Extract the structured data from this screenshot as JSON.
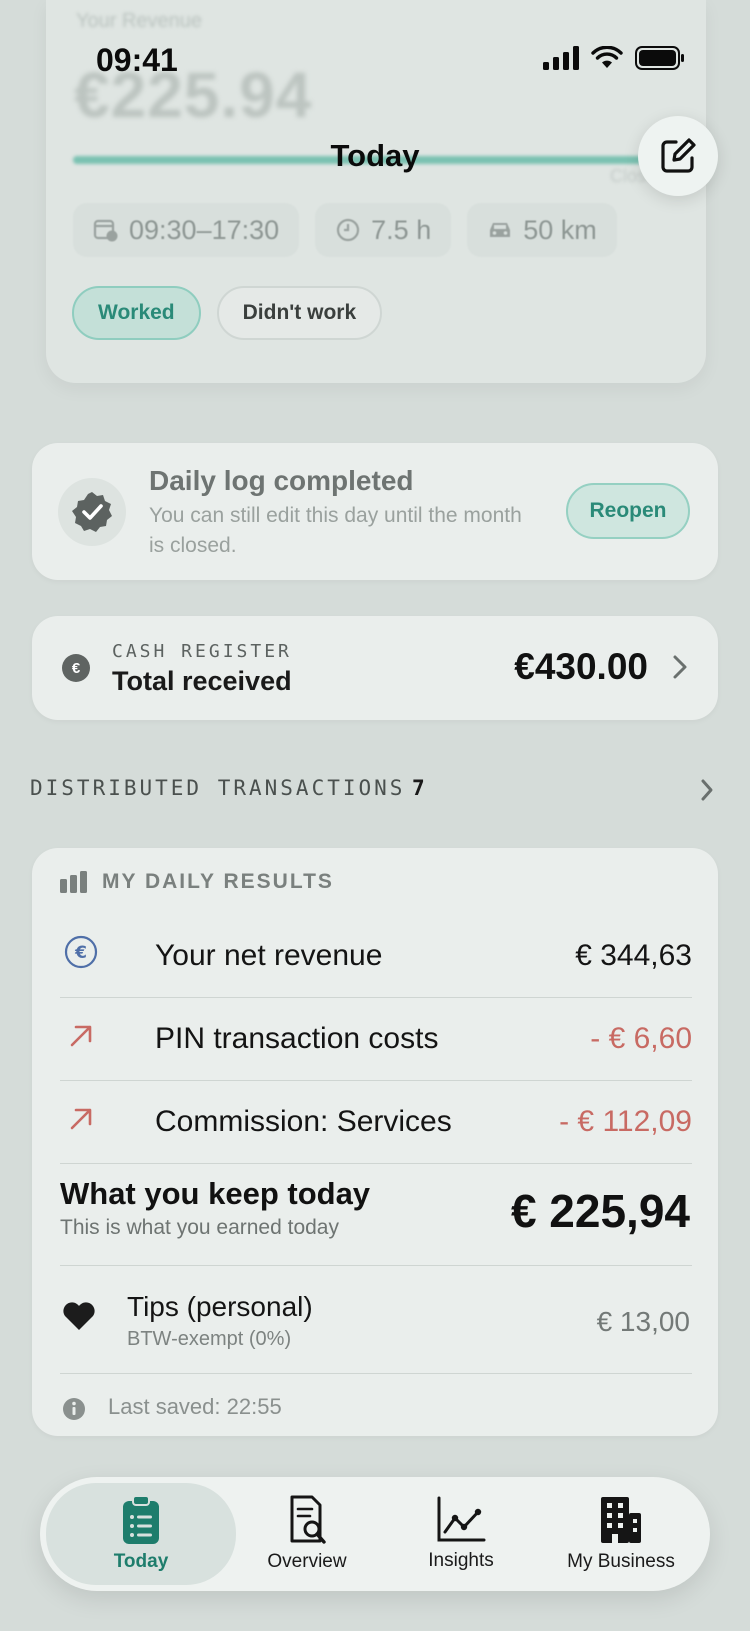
{
  "status_bar": {
    "time": "09:41"
  },
  "header": {
    "title": "Today"
  },
  "summary_card": {
    "ghost_label": "Your Revenue",
    "ghost_amount": "€225.94",
    "ghost_right": "Close",
    "progress": 0.95,
    "shift_time": "09:30–17:30",
    "hours": "7.5 h",
    "distance": "50 km",
    "worked_label": "Worked",
    "didnt_work_label": "Didn't work"
  },
  "daily_log": {
    "title": "Daily log completed",
    "subtitle": "You can still edit this day until the month is closed.",
    "reopen_label": "Reopen"
  },
  "cash_register": {
    "currency_symbol": "€",
    "eyebrow": "CASH REGISTER",
    "label": "Total received",
    "amount": "€430.00"
  },
  "distributed": {
    "label": "DISTRIBUTED TRANSACTIONS",
    "count": "7"
  },
  "daily_results": {
    "title": "MY DAILY RESULTS",
    "rows": [
      {
        "label": "Your net revenue",
        "value": "€ 344,63",
        "negative": false
      },
      {
        "label": "PIN transaction costs",
        "value": "- € 6,60",
        "negative": true
      },
      {
        "label": "Commission: Services",
        "value": "- € 112,09",
        "negative": true
      }
    ],
    "keep_title": "What you keep today",
    "keep_subtitle": "This is what you earned today",
    "keep_amount": "€ 225,94",
    "tips_label": "Tips (personal)",
    "tips_subtitle": "BTW-exempt (0%)",
    "tips_value": "€ 13,00",
    "last_saved": "Last saved: 22:55"
  },
  "tabbar": {
    "tabs": [
      {
        "label": "Today",
        "icon": "clipboard-icon",
        "active": true
      },
      {
        "label": "Overview",
        "icon": "document-search-icon",
        "active": false
      },
      {
        "label": "Insights",
        "icon": "line-chart-icon",
        "active": false
      },
      {
        "label": "My Business",
        "icon": "building-icon",
        "active": false
      }
    ]
  },
  "colors": {
    "accent": "#2a8a78",
    "negative": "#c86a63",
    "background": "#d5dcd9"
  }
}
